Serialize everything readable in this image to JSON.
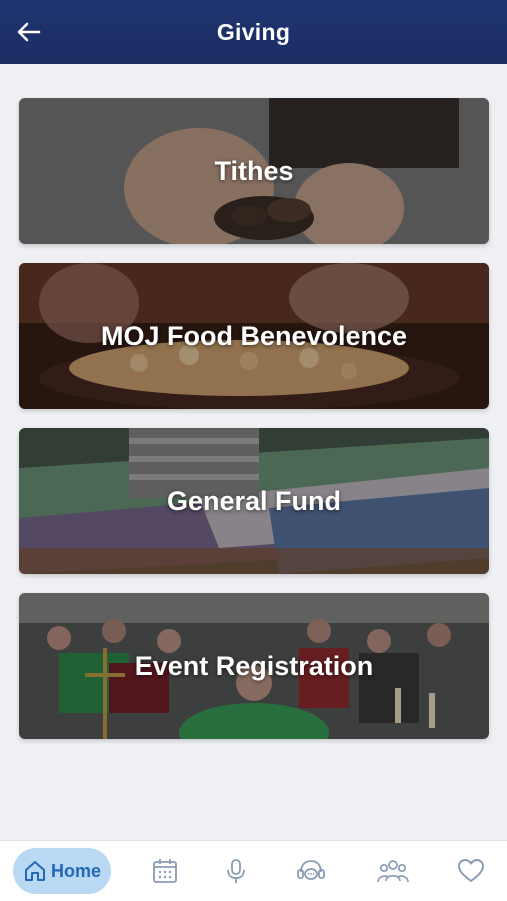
{
  "header": {
    "title": "Giving"
  },
  "cards": [
    {
      "label": "Tithes"
    },
    {
      "label": "MOJ Food Benevolence"
    },
    {
      "label": "General Fund"
    },
    {
      "label": "Event Registration"
    }
  ],
  "tabbar": {
    "home_label": "Home"
  },
  "colors": {
    "header": "#1f3470",
    "accent": "#2468b8",
    "home_pill": "#b9d8f3"
  }
}
